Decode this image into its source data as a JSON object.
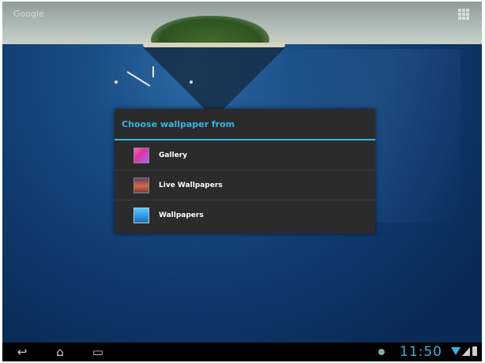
{
  "launcher": {
    "search_hint": "Google"
  },
  "dialog": {
    "title": "Choose wallpaper from",
    "options": [
      {
        "label": "Gallery",
        "icon": "gallery-icon"
      },
      {
        "label": "Live Wallpapers",
        "icon": "live-wallpapers-icon"
      },
      {
        "label": "Wallpapers",
        "icon": "wallpapers-icon"
      }
    ]
  },
  "status_bar": {
    "time": "11:50"
  },
  "colors": {
    "accent": "#33b5e5",
    "dialog_bg": "#2b2b2b",
    "navbar_bg": "#000000"
  }
}
